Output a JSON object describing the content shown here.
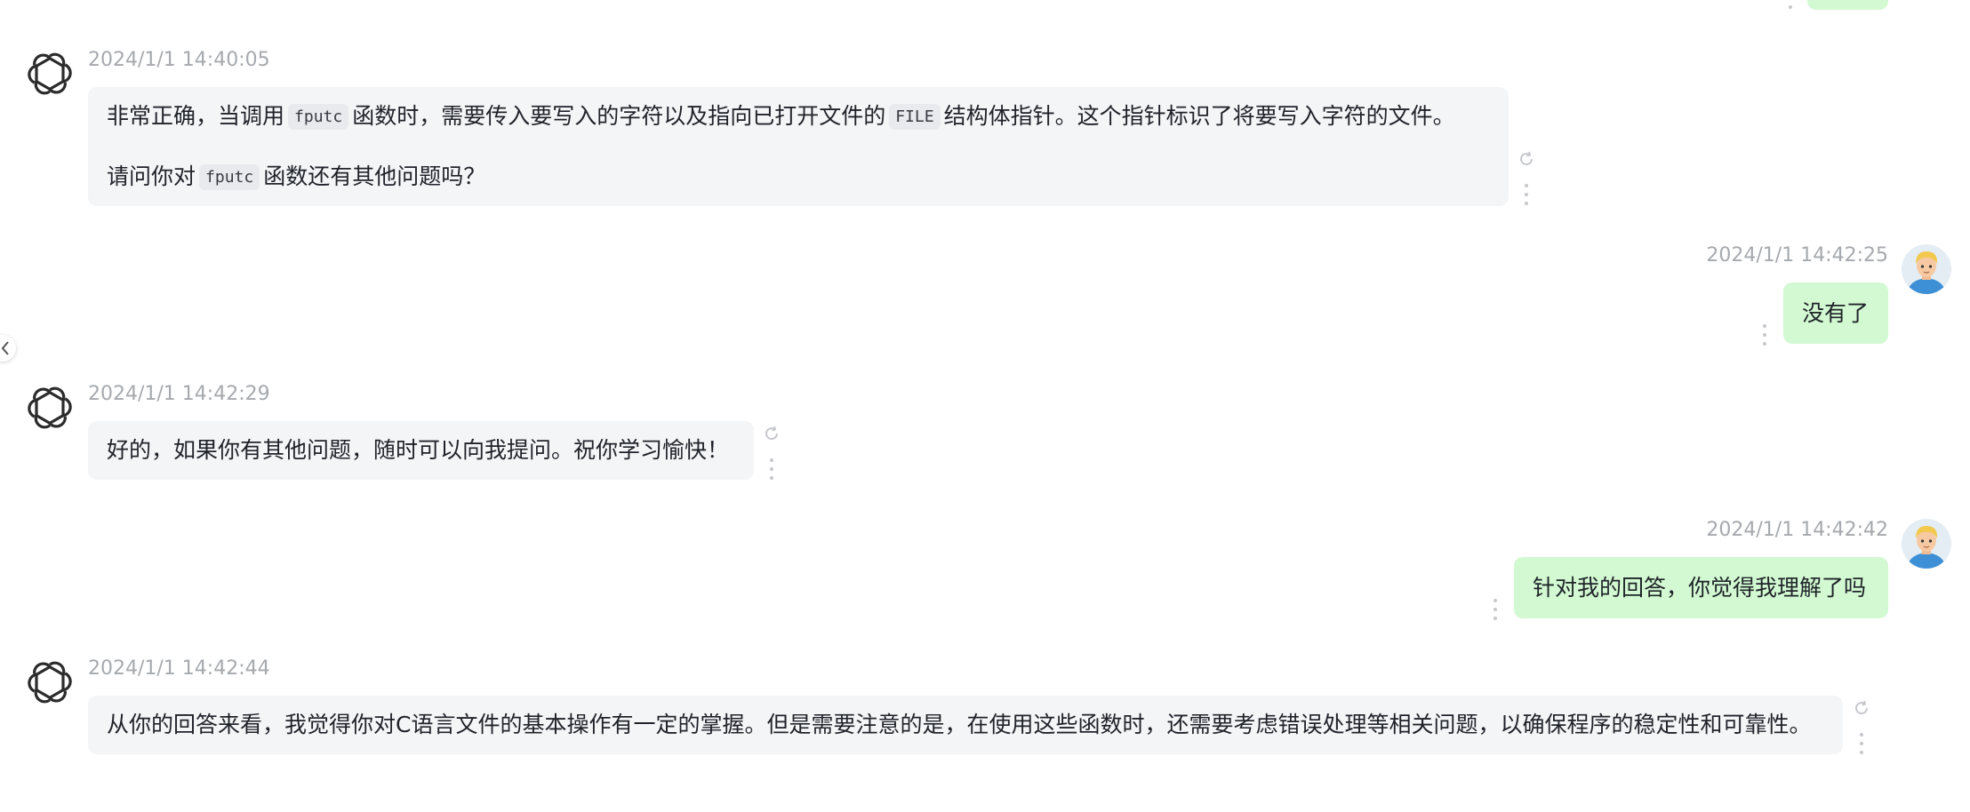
{
  "messages": [
    {
      "role": "assistant",
      "timestamp": "2024/1/1 14:40:05",
      "paragraphs": [
        {
          "p1_part1": "非常正确，当调用",
          "code1": "fputc",
          "p1_part2": "函数时，需要传入要写入的字符以及指向已打开文件的",
          "code2": "FILE",
          "p1_part3": "结构体指针。这个指针标识了将要写入字符的文件。"
        },
        {
          "p2_part1": "请问你对",
          "code1": "fputc",
          "p2_part2": "函数还有其他问题吗？"
        }
      ]
    },
    {
      "role": "user",
      "timestamp": "2024/1/1 14:42:25",
      "text": "没有了"
    },
    {
      "role": "assistant",
      "timestamp": "2024/1/1 14:42:29",
      "text": "好的，如果你有其他问题，随时可以向我提问。祝你学习愉快！"
    },
    {
      "role": "user",
      "timestamp": "2024/1/1 14:42:42",
      "text": "针对我的回答，你觉得我理解了吗"
    },
    {
      "role": "assistant",
      "timestamp": "2024/1/1 14:42:44",
      "text": "从你的回答来看，我觉得你对C语言文件的基本操作有一定的掌握。但是需要注意的是，在使用这些函数时，还需要考虑错误处理等相关问题，以确保程序的稳定性和可靠性。"
    }
  ],
  "icons": {
    "assistant_avatar": "openai-logo-icon",
    "user_avatar": "user-avatar-icon",
    "regenerate": "refresh-icon",
    "more": "more-vertical-icon",
    "collapse": "chevron-left-icon"
  },
  "colors": {
    "assistant_bubble": "#f4f5f7",
    "user_bubble": "#d2f9d1",
    "timestamp": "#a6a9ad",
    "text": "#1f2329"
  }
}
